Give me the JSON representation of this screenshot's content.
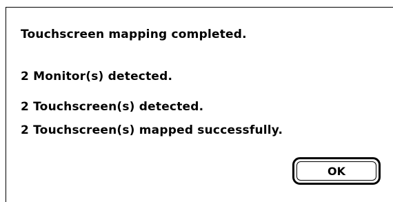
{
  "dialog": {
    "title_message": "Touchscreen mapping completed.",
    "lines": [
      "2 Monitor(s) detected.",
      "2 Touchscreen(s) detected.",
      "2 Touchscreen(s) mapped successfully."
    ],
    "ok_label": "OK"
  },
  "colors": {
    "background": "#ffffff",
    "text": "#000000",
    "border": "#000000"
  }
}
